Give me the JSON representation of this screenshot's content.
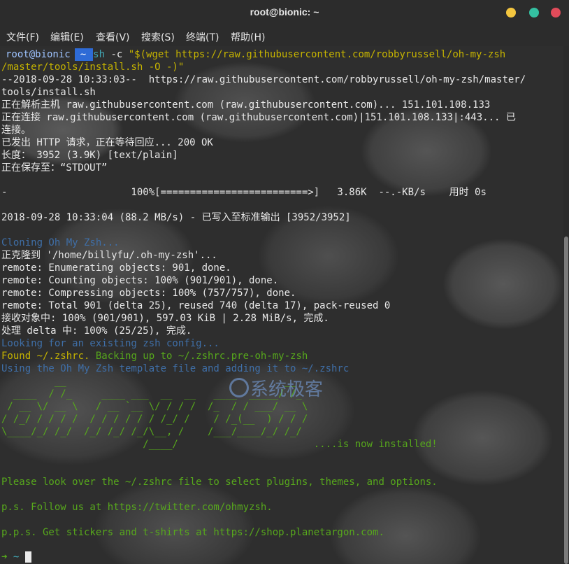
{
  "window": {
    "title": "root@bionic: ~"
  },
  "menu": [
    "文件(F)",
    "编辑(E)",
    "查看(V)",
    "搜索(S)",
    "终端(T)",
    "帮助(H)"
  ],
  "prompt": {
    "user": "root@bionic",
    "dir": "~",
    "cmd": "sh",
    "args": " -c ",
    "quoted_1": "\"$(wget https://raw.githubusercontent.com/robbyrussell/oh-my-zsh",
    "quoted_2": "/master/tools/install.sh -O -)\""
  },
  "output": {
    "l1": "--2018-09-28 10:33:03--  https://raw.githubusercontent.com/robbyrussell/oh-my-zsh/master/",
    "l2": "tools/install.sh",
    "l3": "正在解析主机 raw.githubusercontent.com (raw.githubusercontent.com)... 151.101.108.133",
    "l4": "正在连接 raw.githubusercontent.com (raw.githubusercontent.com)|151.101.108.133|:443... 已",
    "l5": "连接。",
    "l6": "已发出 HTTP 请求，正在等待回应... 200 OK",
    "l7": "长度： 3952 (3.9K) [text/plain]",
    "l8": "正在保存至：“STDOUT”",
    "l9": "-                     100%[=========================>]   3.86K  --.-KB/s    用时 0s",
    "l10": "2018-09-28 10:33:04 (88.2 MB/s) - 已写入至标准输出 [3952/3952]",
    "l11": "Cloning Oh My Zsh...",
    "l12": "正克隆到 '/home/billyfu/.oh-my-zsh'...",
    "l13": "remote: Enumerating objects: 901, done.",
    "l14": "remote: Counting objects: 100% (901/901), done.",
    "l15": "remote: Compressing objects: 100% (757/757), done.",
    "l16": "remote: Total 901 (delta 25), reused 740 (delta 17), pack-reused 0",
    "l17": "接收对象中: 100% (901/901), 597.03 KiB | 2.28 MiB/s, 完成.",
    "l18": "处理 delta 中: 100% (25/25), 完成.",
    "l19": "Looking for an existing zsh config...",
    "l20_a": "Found ~/.zshrc.",
    "l20_b": " Backing up to ~/.zshrc.pre-oh-my-zsh",
    "l21": "Using the Oh My Zsh template file and adding it to ~/.zshrc",
    "art": [
      "         __                                     __",
      "  ____  / /_     ____ ___  __  __   ____  _____/ /_",
      " / __ \\/ __ \\   / __ `__ \\/ / / /  /_  / / ___/ __ \\",
      "/ /_/ / / / /  / / / / / / /_/ /    / /_(__  ) / / /",
      "\\____/_/ /_/  /_/ /_/ /_/\\__, /    /___/____/_/ /_/",
      "                        /____/                       ....is now installed!"
    ],
    "l23": "Please look over the ~/.zshrc file to select plugins, themes, and options.",
    "l24": "p.s. Follow us at https://twitter.com/ohmyzsh.",
    "l25": "p.p.s. Get stickers and t-shirts at https://shop.planetargon.com.",
    "final_arrow": "➜",
    "final_dir": "~"
  },
  "watermark": "系统极客",
  "colors": {
    "accent_blue": "#2e6bd6",
    "green": "#57a81c",
    "yellow": "#c6b400",
    "dim_blue": "#3f6fa8"
  }
}
